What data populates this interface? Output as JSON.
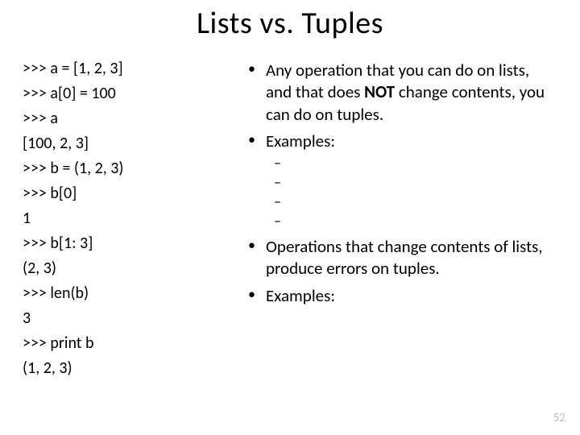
{
  "title": "Lists vs. Tuples",
  "code_lines": [
    ">>> a = [1, 2, 3]",
    ">>> a[0] = 100",
    ">>> a",
    "[100, 2, 3]",
    ">>> b = (1, 2, 3)",
    ">>> b[0]",
    "1",
    ">>> b[1: 3]",
    "(2, 3)",
    ">>> len(b)",
    "3",
    ">>> print b",
    "(1, 2, 3)"
  ],
  "bullets": {
    "b1_pre": "Any operation that you can do on lists, and that does ",
    "b1_bold": "NOT",
    "b1_post": " change contents, you can do on tuples.",
    "b2": "Examples:",
    "b3": "Operations that change contents of lists, produce errors on tuples.",
    "b4": "Examples:"
  },
  "page_number": "52"
}
